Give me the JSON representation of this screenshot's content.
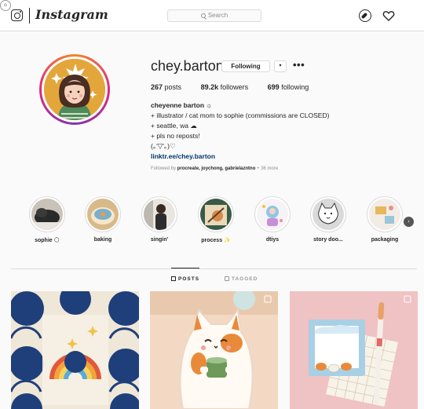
{
  "nav": {
    "brand": "Instagram",
    "search_placeholder": "Search",
    "icons": [
      "instagram-glyph-icon",
      "compass-icon",
      "heart-icon",
      "profile-icon"
    ]
  },
  "profile": {
    "username": "chey.barton",
    "following_label": "Following",
    "caret": "▾",
    "more": "•••",
    "stats": {
      "posts_count": "267",
      "posts_label": "posts",
      "followers_count": "89.2k",
      "followers_label": "followers",
      "following_count": "699",
      "following_label": "following"
    },
    "bio": {
      "display_name": "cheyenne barton ☼",
      "line1": "+ illustrator / cat mom to sophie (commissions are CLOSED)",
      "line2": "+ seattle, wa ☁",
      "line3": "+ pls no reposts!",
      "line4": "(｡'▽'｡)♡",
      "link": "linktr.ee/chey.barton"
    },
    "followed_by": {
      "prefix": "Followed by ",
      "names": "procreate, joychong, gabrielazntno",
      "suffix": " + 36 more"
    }
  },
  "highlights": [
    {
      "label": "sophie 🌕"
    },
    {
      "label": "baking"
    },
    {
      "label": "singin'"
    },
    {
      "label": "process ✨"
    },
    {
      "label": "dtiys"
    },
    {
      "label": "story doo..."
    },
    {
      "label": "packaging"
    }
  ],
  "tabs": [
    {
      "label": "POSTS",
      "active": true
    },
    {
      "label": "TAGGED",
      "active": false
    }
  ],
  "colors": {
    "accent_link": "#003569",
    "ring_gradient": [
      "#f58529",
      "#dd2a7b",
      "#8134af"
    ]
  }
}
